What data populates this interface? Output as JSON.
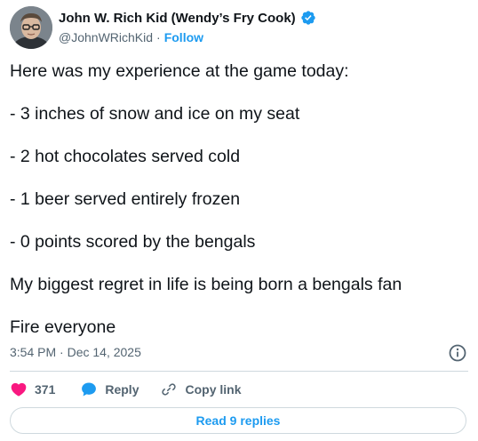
{
  "author": {
    "display_name": "John W. Rich Kid (Wendy’s Fry Cook)",
    "handle": "@JohnWRichKid",
    "separator": "·",
    "follow_label": "Follow",
    "verified": true
  },
  "tweet": {
    "paragraphs": [
      "Here was my experience at the game today:",
      "- 3 inches of snow and ice on my seat",
      "- 2 hot chocolates served cold",
      "- 1 beer served entirely frozen",
      "- 0 points scored by the bengals",
      "My biggest regret in life is being born a bengals fan",
      "Fire everyone"
    ],
    "timestamp": "3:54 PM · Dec 14, 2025"
  },
  "actions": {
    "like_count": "371",
    "reply_label": "Reply",
    "copy_link_label": "Copy link"
  },
  "read_replies_label": "Read 9 replies",
  "colors": {
    "accent": "#1d9bf0",
    "like": "#f91880",
    "text": "#0f1419",
    "muted": "#536471",
    "border": "#cfd9de"
  },
  "icons": {
    "verified": "verified-badge-icon",
    "info": "info-icon",
    "like": "heart-icon",
    "reply": "speech-bubble-icon",
    "copy_link": "link-icon"
  }
}
